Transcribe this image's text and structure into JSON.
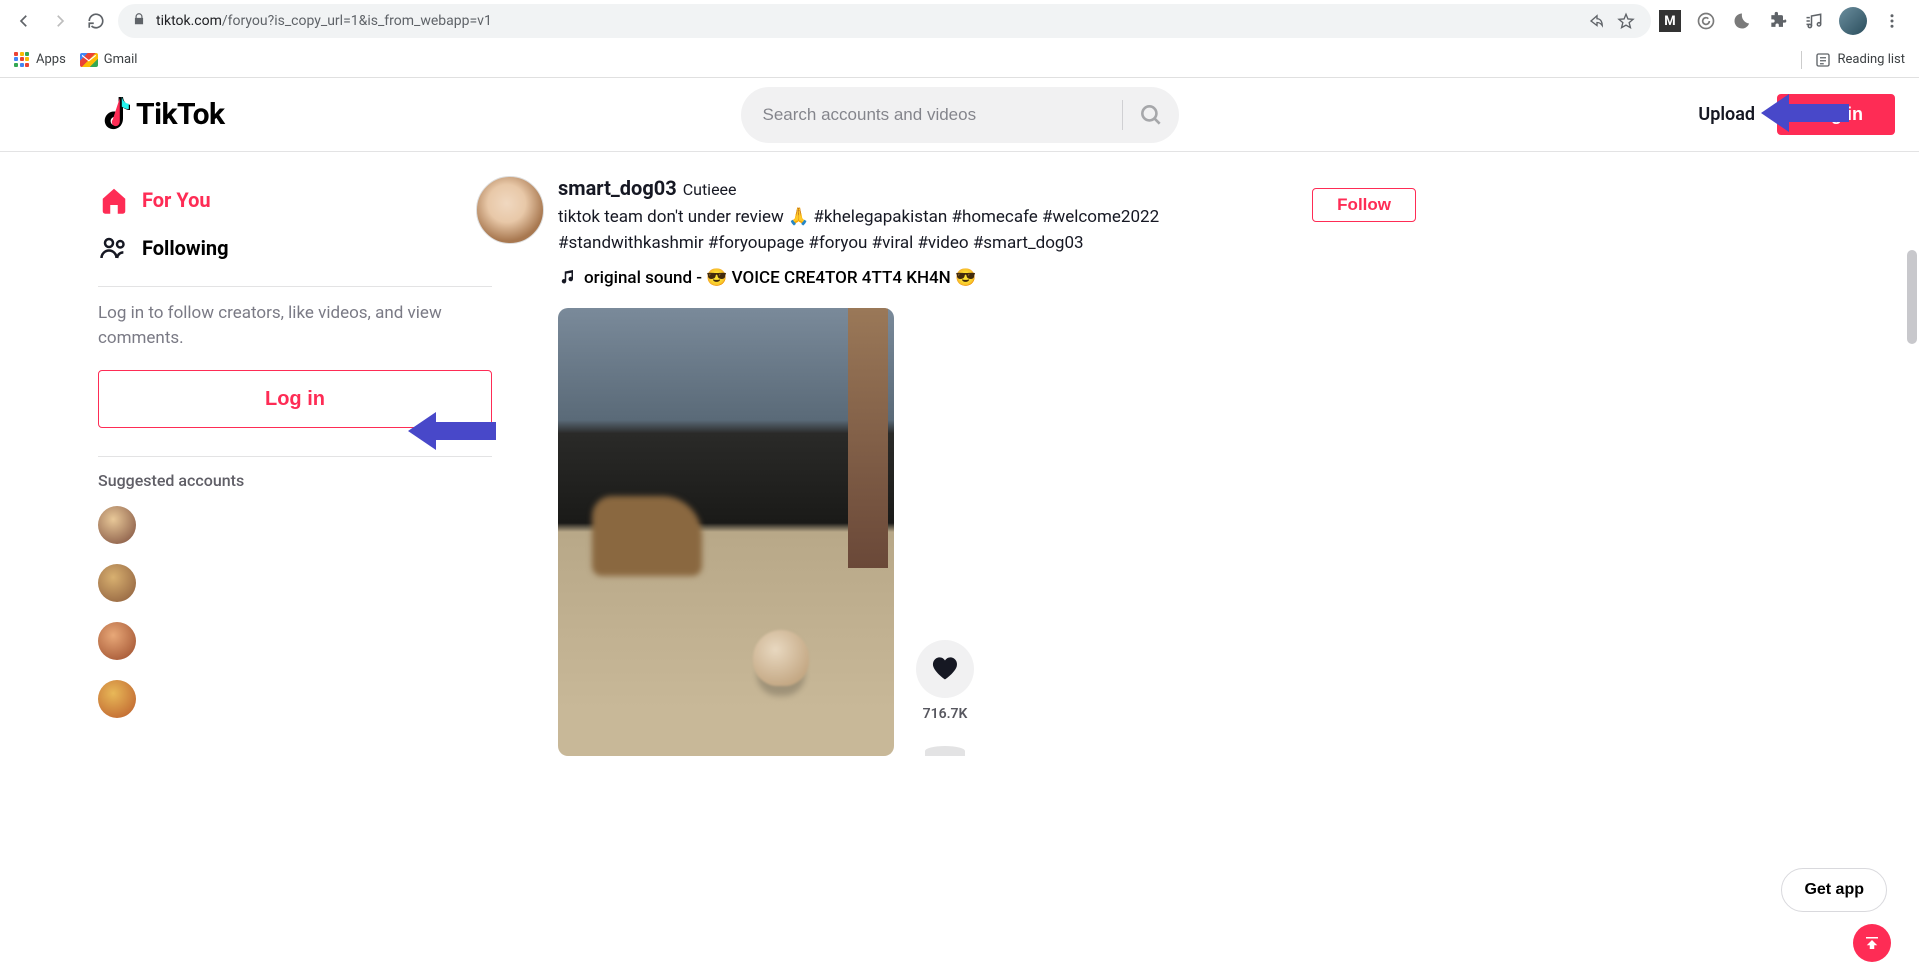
{
  "browser": {
    "url_domain": "tiktok.com",
    "url_path": "/foryou?is_copy_url=1&is_from_webapp=v1",
    "bookmarks": {
      "apps": "Apps",
      "gmail": "Gmail",
      "reading_list": "Reading list"
    }
  },
  "header": {
    "logo_text": "TikTok",
    "search_placeholder": "Search accounts and videos",
    "upload_label": "Upload",
    "login_label": "Log in"
  },
  "sidebar": {
    "nav": {
      "for_you": "For You",
      "following": "Following"
    },
    "login_prompt": "Log in to follow creators, like videos, and view comments.",
    "login_button": "Log in",
    "suggested_heading": "Suggested accounts"
  },
  "post": {
    "username": "smart_dog03",
    "displayname": "Cutieee",
    "caption": "tiktok team don't under review 🙏 #khelegapakistan #homecafe #welcome2022 #standwithkashmir #foryoupage #foryou #viral #video #smart_dog03",
    "sound": "original sound - 😎 VOICE CRE4TOR 4TT4 KH4N 😎",
    "follow_label": "Follow",
    "like_count": "716.7K"
  },
  "floating": {
    "get_app": "Get app"
  },
  "colors": {
    "primary": "#fe2c55",
    "arrow": "#4848c9"
  }
}
